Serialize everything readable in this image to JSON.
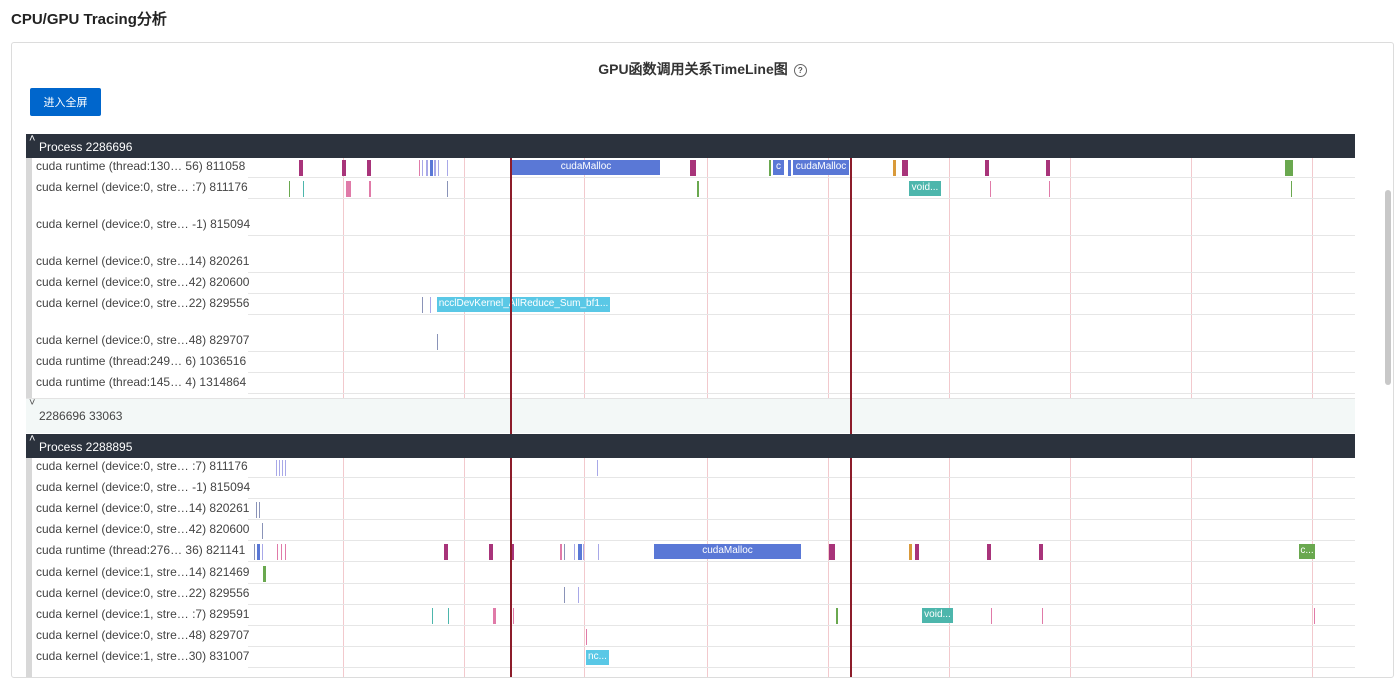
{
  "page": {
    "title": "CPU/GPU Tracing分析"
  },
  "chart": {
    "title": "GPU函数调用关系TimeLine图",
    "help_icon": "question-circle-icon",
    "help_glyph": "?"
  },
  "toolbar": {
    "fullscreen_label": "进入全屏"
  },
  "colors": {
    "header_bg": "#2b323d",
    "button_bg": "#0066cc",
    "marker": "#8c1c2a",
    "grid": "#f2c9cd",
    "cuda_malloc": "#5a78d6",
    "nccl": "#5ac8e6",
    "void": "#4db6ac",
    "magenta": "#a8347a",
    "green": "#6aa84f",
    "orange": "#d99a3a",
    "lavender": "#a8a8e8",
    "pink": "#e07aa8",
    "slate": "#8a93b8"
  },
  "processes": [
    {
      "header": "Process 2286696",
      "collapse_icon": "chevron-up-icon",
      "rows": [
        {
          "label": "cuda runtime (thread:130…  56) 811058",
          "marks": [
            {
              "t": 51,
              "c": "magenta"
            },
            {
              "t": 94,
              "c": "magenta"
            },
            {
              "t": 119,
              "c": "magenta"
            },
            {
              "t": 171,
              "c": "pink",
              "s": 1
            },
            {
              "t": 174,
              "c": "lavender",
              "s": 1
            },
            {
              "t": 178,
              "c": "lavender",
              "s": 2
            },
            {
              "t": 182,
              "c": "cuda_malloc",
              "s": 3
            },
            {
              "t": 186,
              "c": "lavender",
              "s": 2
            },
            {
              "t": 190,
              "c": "lavender",
              "s": 1
            },
            {
              "t": 199,
              "c": "lavender",
              "s": 1
            },
            {
              "t": 264,
              "e": 412,
              "c": "cuda_malloc",
              "text": "cudaMalloc"
            },
            {
              "t": 442,
              "c": "magenta",
              "s": 6
            },
            {
              "t": 521,
              "c": "green",
              "s": 2
            },
            {
              "t": 525,
              "e": 536,
              "c": "cuda_malloc",
              "text": "c"
            },
            {
              "t": 540,
              "c": "cuda_malloc",
              "s": 3
            },
            {
              "t": 545,
              "e": 601,
              "c": "cuda_malloc",
              "text": "cudaMalloc"
            },
            {
              "t": 645,
              "c": "orange",
              "s": 3
            },
            {
              "t": 654,
              "c": "magenta",
              "s": 6
            },
            {
              "t": 737,
              "c": "magenta"
            },
            {
              "t": 798,
              "c": "magenta"
            },
            {
              "t": 1037,
              "c": "green",
              "s": 8
            }
          ]
        },
        {
          "label": "cuda kernel (device:0, stre…  :7) 811176",
          "marks": [
            {
              "t": 41,
              "c": "green",
              "s": 1
            },
            {
              "t": 55,
              "c": "void",
              "s": 1
            },
            {
              "t": 98,
              "c": "pink",
              "s": 5
            },
            {
              "t": 121,
              "c": "pink",
              "s": 2
            },
            {
              "t": 199,
              "c": "slate",
              "s": 1
            },
            {
              "t": 449,
              "c": "green",
              "s": 2
            },
            {
              "t": 661,
              "e": 693,
              "c": "void",
              "text": "void..."
            },
            {
              "t": 742,
              "c": "pink",
              "s": 1
            },
            {
              "t": 801,
              "c": "pink",
              "s": 1
            },
            {
              "t": 1043,
              "c": "green",
              "s": 1
            }
          ]
        },
        {
          "label": "cuda kernel (device:0, stre…  -1) 815094",
          "marks": []
        },
        {
          "label": "cuda kernel (device:0, stre…14) 820261",
          "marks": []
        },
        {
          "label": "cuda kernel (device:0, stre…42) 820600",
          "marks": []
        },
        {
          "label": "cuda kernel (device:0, stre…22) 829556",
          "marks": [
            {
              "t": 174,
              "c": "slate",
              "s": 1
            },
            {
              "t": 182,
              "c": "lavender",
              "s": 1
            },
            {
              "t": 189,
              "e": 362,
              "c": "nccl",
              "text": "ncclDevKernel_AllReduce_Sum_bf1..."
            }
          ]
        },
        {
          "label": "cuda kernel (device:0, stre…48) 829707",
          "marks": [
            {
              "t": 189,
              "c": "slate",
              "s": 1
            }
          ]
        },
        {
          "label": "cuda runtime (thread:249…  6) 1036516",
          "marks": []
        },
        {
          "label": "cuda runtime (thread:145…  4) 1314864",
          "marks": []
        }
      ],
      "collapsed": {
        "label": "2286696 33063",
        "icon": "chevron-down-icon"
      }
    },
    {
      "header": "Process 2288895",
      "collapse_icon": "chevron-up-icon",
      "rows": [
        {
          "label": "cuda kernel (device:0, stre…  :7) 811176",
          "marks": [
            {
              "t": 28,
              "c": "lavender",
              "s": 1
            },
            {
              "t": 31,
              "c": "lavender",
              "s": 1
            },
            {
              "t": 34,
              "c": "lavender",
              "s": 1
            },
            {
              "t": 37,
              "c": "lavender",
              "s": 1
            },
            {
              "t": 349,
              "c": "lavender",
              "s": 1
            }
          ]
        },
        {
          "label": "cuda kernel (device:0, stre…  -1) 815094",
          "marks": []
        },
        {
          "label": "cuda kernel (device:0, stre…14) 820261",
          "marks": [
            {
              "t": 8,
              "c": "slate",
              "s": 1
            },
            {
              "t": 11,
              "c": "slate",
              "s": 1
            }
          ]
        },
        {
          "label": "cuda kernel (device:0, stre…42) 820600",
          "marks": [
            {
              "t": 14,
              "c": "slate",
              "s": 1
            }
          ]
        },
        {
          "label": "cuda runtime (thread:276…  36) 821141",
          "marks": [
            {
              "t": 6,
              "c": "slate",
              "s": 1
            },
            {
              "t": 9,
              "c": "cuda_malloc",
              "s": 3
            },
            {
              "t": 14,
              "c": "lavender",
              "s": 1
            },
            {
              "t": 29,
              "c": "pink",
              "s": 1
            },
            {
              "t": 33,
              "c": "pink",
              "s": 1
            },
            {
              "t": 37,
              "c": "pink",
              "s": 1
            },
            {
              "t": 196,
              "c": "magenta"
            },
            {
              "t": 241,
              "c": "magenta"
            },
            {
              "t": 264,
              "c": "magenta",
              "s": 2
            },
            {
              "t": 312,
              "c": "pink",
              "s": 2
            },
            {
              "t": 316,
              "c": "slate",
              "s": 1
            },
            {
              "t": 326,
              "c": "lavender",
              "s": 1
            },
            {
              "t": 330,
              "c": "cuda_malloc",
              "s": 4
            },
            {
              "t": 335,
              "c": "lavender",
              "s": 1
            },
            {
              "t": 350,
              "c": "lavender",
              "s": 1
            },
            {
              "t": 406,
              "e": 553,
              "c": "cuda_malloc",
              "text": "cudaMalloc"
            },
            {
              "t": 581,
              "c": "magenta",
              "s": 6
            },
            {
              "t": 661,
              "c": "orange",
              "s": 3
            },
            {
              "t": 667,
              "c": "magenta"
            },
            {
              "t": 739,
              "c": "magenta"
            },
            {
              "t": 791,
              "c": "magenta"
            },
            {
              "t": 1051,
              "e": 1067,
              "c": "green",
              "text": "c..."
            }
          ]
        },
        {
          "label": "cuda kernel (device:1, stre…14) 821469",
          "marks": [
            {
              "t": 15,
              "c": "green",
              "s": 3
            }
          ]
        },
        {
          "label": "cuda kernel (device:0, stre…22) 829556",
          "marks": [
            {
              "t": 316,
              "c": "slate",
              "s": 1
            },
            {
              "t": 330,
              "c": "lavender",
              "s": 1
            }
          ]
        },
        {
          "label": "cuda kernel (device:1, stre…  :7) 829591",
          "marks": [
            {
              "t": 184,
              "c": "void",
              "s": 1
            },
            {
              "t": 200,
              "c": "void",
              "s": 1
            },
            {
              "t": 245,
              "c": "pink",
              "s": 3
            },
            {
              "t": 265,
              "c": "pink",
              "s": 1
            },
            {
              "t": 588,
              "c": "green",
              "s": 2
            },
            {
              "t": 674,
              "e": 705,
              "c": "void",
              "text": "void..."
            },
            {
              "t": 743,
              "c": "pink",
              "s": 1
            },
            {
              "t": 794,
              "c": "pink",
              "s": 1
            },
            {
              "t": 1066,
              "c": "pink",
              "s": 1
            }
          ]
        },
        {
          "label": "cuda kernel (device:0, stre…48) 829707",
          "marks": [
            {
              "t": 338,
              "c": "pink",
              "s": 1
            }
          ]
        },
        {
          "label": "cuda kernel (device:1, stre…30) 831007",
          "marks": [
            {
              "t": 338,
              "e": 361,
              "c": "nccl",
              "text": "nc..."
            }
          ]
        }
      ]
    }
  ]
}
